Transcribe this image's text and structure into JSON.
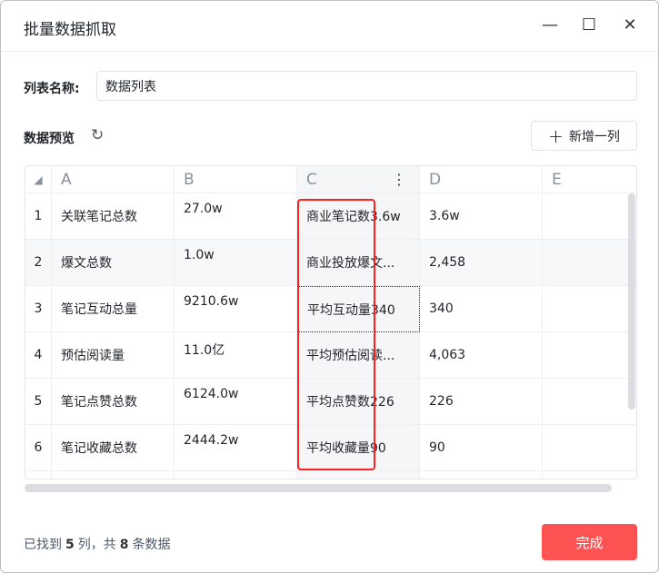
{
  "window": {
    "title": "批量数据抓取",
    "minimize": "—",
    "maximize": "☐",
    "close": "✕"
  },
  "list_name": {
    "label": "列表名称:",
    "value": "数据列表"
  },
  "preview": {
    "label": "数据预览",
    "refresh_icon": "↻",
    "add_column": "新增一列",
    "add_icon": "+"
  },
  "table": {
    "corner": "◢",
    "columns": [
      "A",
      "B",
      "C",
      "D",
      "E"
    ],
    "column_menu": "⋮",
    "rows": [
      {
        "num": "1",
        "A": "关联笔记总数",
        "B": "27.0w",
        "C": "商业笔记数3.6w",
        "D": "3.6w",
        "E": ""
      },
      {
        "num": "2",
        "A": "爆文总数",
        "B": "1.0w",
        "C": "商业投放爆文...",
        "D": "2,458",
        "E": ""
      },
      {
        "num": "3",
        "A": "笔记互动总量",
        "B": "9210.6w",
        "C": "平均互动量340",
        "D": "340",
        "E": ""
      },
      {
        "num": "4",
        "A": "预估阅读量",
        "B": "11.0亿",
        "C": "平均预估阅读...",
        "D": "4,063",
        "E": ""
      },
      {
        "num": "5",
        "A": "笔记点赞总数",
        "B": "6124.0w",
        "C": "平均点赞数226",
        "D": "226",
        "E": ""
      },
      {
        "num": "6",
        "A": "笔记收藏总数",
        "B": "2444.2w",
        "C": "平均收藏量90",
        "D": "90",
        "E": ""
      }
    ]
  },
  "footer": {
    "prefix": "已找到",
    "columns": "5",
    "mid": "列，共",
    "rows": "8",
    "suffix": "条数据",
    "done": "完成"
  },
  "colors": {
    "accent": "#ff5353",
    "highlight": "#ff1f1f"
  }
}
